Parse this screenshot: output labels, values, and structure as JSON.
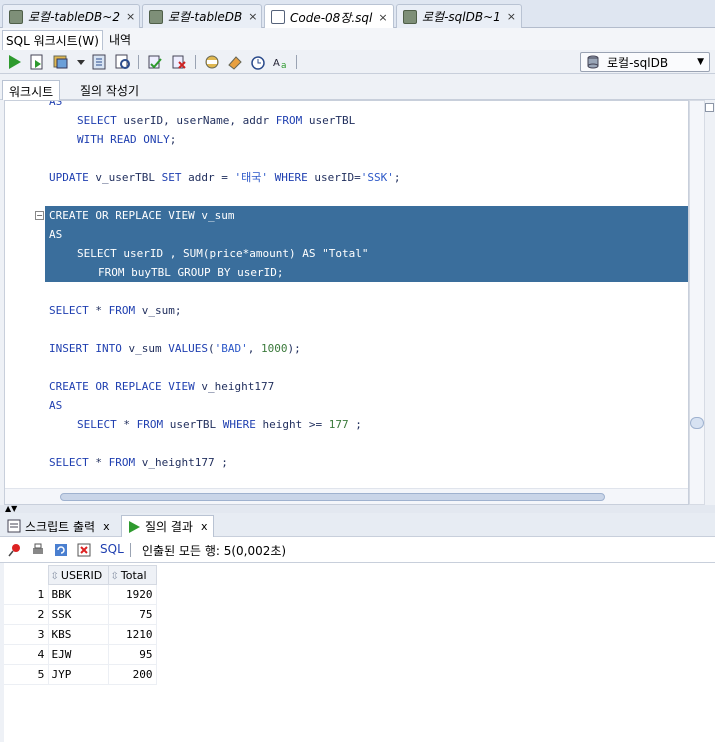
{
  "doc_tabs": [
    {
      "label": "로컬-tableDB~2",
      "close": "×"
    },
    {
      "label": "로컬-tableDB",
      "close": "×"
    },
    {
      "label": "Code-08장.sql",
      "close": "×"
    },
    {
      "label": "로컬-sqlDB~1",
      "close": "×"
    }
  ],
  "sub_tabs": {
    "worksheet": "SQL 워크시트(W)",
    "history": "내역"
  },
  "toolbar": {
    "connection": "로컬-sqlDB"
  },
  "ws_tabs": {
    "worksheet": "워크시트",
    "query_builder": "질의 작성기"
  },
  "editor": {
    "lines": [
      {
        "t": "AS",
        "indent": 0
      },
      {
        "t": "SELECT userID, userName, addr FROM userTBL",
        "indent": 1
      },
      {
        "t": "WITH READ ONLY;",
        "indent": 1
      },
      {
        "t": "",
        "indent": 0
      },
      {
        "t": "UPDATE v_userTBL SET addr = '태국' WHERE userID='SSK';",
        "indent": 0
      },
      {
        "t": "",
        "indent": 0
      },
      {
        "t": "CREATE OR REPLACE VIEW v_sum",
        "indent": 0,
        "sel": true
      },
      {
        "t": "AS",
        "indent": 0,
        "sel": true
      },
      {
        "t": "SELECT userID , SUM(price*amount) AS \"Total\"",
        "indent": 1,
        "sel": true
      },
      {
        "t": "FROM buyTBL GROUP BY userID;",
        "indent": 2,
        "sel": true
      },
      {
        "t": "",
        "indent": 0
      },
      {
        "t": "SELECT * FROM v_sum;",
        "indent": 0
      },
      {
        "t": "",
        "indent": 0
      },
      {
        "t": "INSERT INTO v_sum VALUES('BAD', 1000);",
        "indent": 0
      },
      {
        "t": "",
        "indent": 0
      },
      {
        "t": "CREATE OR REPLACE VIEW v_height177",
        "indent": 0
      },
      {
        "t": "AS",
        "indent": 0
      },
      {
        "t": "SELECT * FROM userTBL WHERE height >= 177 ;",
        "indent": 1
      },
      {
        "t": "",
        "indent": 0
      },
      {
        "t": "SELECT * FROM v_height177 ;",
        "indent": 0
      }
    ]
  },
  "output_tabs": {
    "script_output": "스크립트 출력",
    "query_result": "질의 결과",
    "close": "x"
  },
  "result_toolbar": {
    "sql_label": "SQL",
    "status": "인출된 모든 행: 5(0,002초)"
  },
  "grid": {
    "columns": [
      "USERID",
      "Total"
    ],
    "rows": [
      {
        "n": "1",
        "userid": "BBK",
        "total": "1920"
      },
      {
        "n": "2",
        "userid": "SSK",
        "total": "75"
      },
      {
        "n": "3",
        "userid": "KBS",
        "total": "1210"
      },
      {
        "n": "4",
        "userid": "EJW",
        "total": "95"
      },
      {
        "n": "5",
        "userid": "JYP",
        "total": "200"
      }
    ]
  }
}
